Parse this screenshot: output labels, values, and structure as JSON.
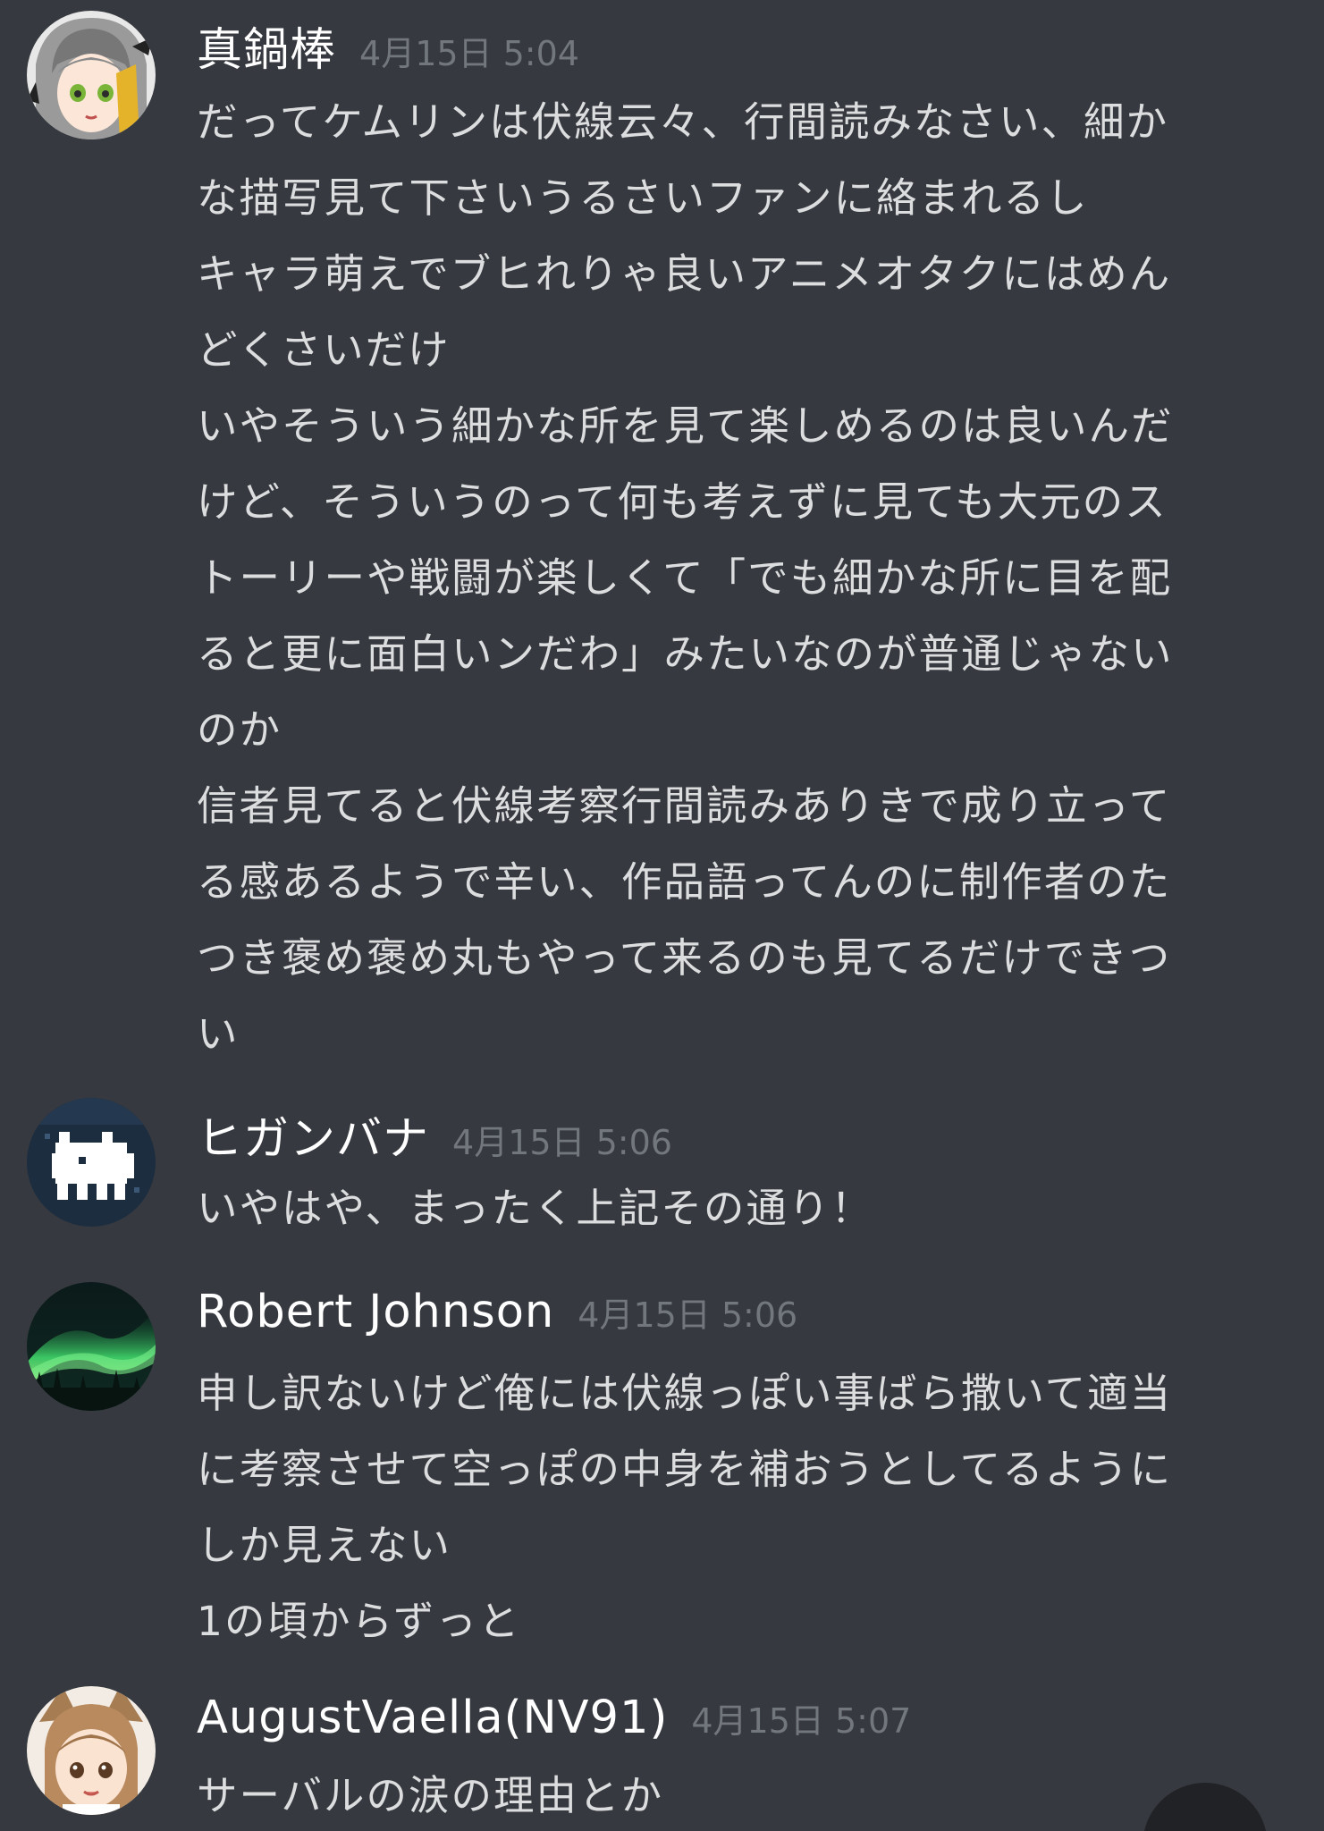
{
  "messages": [
    {
      "username": "真鍋棒",
      "timestamp": "4月15日 5:04",
      "avatar_icon": "anime-girl-avatar-icon",
      "lines": [
        "だってケムリンは伏線云々、行間読みなさい、細か",
        "な描写見て下さいうるさいファンに絡まれるし",
        "キャラ萌えでブヒれりゃ良いアニメオタクにはめん",
        "どくさいだけ",
        "いやそういう細かな所を見て楽しめるのは良いんだ",
        "けど、そういうのって何も考えずに見ても大元のス",
        "トーリーや戦闘が楽しくて「でも細かな所に目を配",
        "ると更に面白いンだわ」みたいなのが普通じゃない",
        "のか",
        "信者見てると伏線考察行間読みありきで成り立って",
        "る感あるようで辛い、作品語ってんのに制作者のた",
        "つき褒め褒め丸もやって来るのも見てるだけできつ",
        "い"
      ]
    },
    {
      "username": "ヒガンバナ",
      "timestamp": "4月15日 5:06",
      "avatar_icon": "pixel-creature-avatar-icon",
      "lines": [
        "いやはや、まったく上記その通り！"
      ]
    },
    {
      "username": "Robert Johnson",
      "timestamp": "4月15日 5:06",
      "avatar_icon": "aurora-avatar-icon",
      "lines": [
        "申し訳ないけど俺には伏線っぽい事ばら撒いて適当",
        "に考察させて空っぽの中身を補おうとしてるように",
        "しか見えない",
        "1の頃からずっと"
      ]
    },
    {
      "username": "AugustVaella(NV91)",
      "timestamp": "4月15日 5:07",
      "avatar_icon": "anime-serval-avatar-icon",
      "lines": [
        "サーバルの涙の理由とか"
      ]
    }
  ],
  "colors": {
    "background": "#36393f",
    "username": "#ffffff",
    "timestamp": "#72767d",
    "message_text": "#dcddde"
  }
}
